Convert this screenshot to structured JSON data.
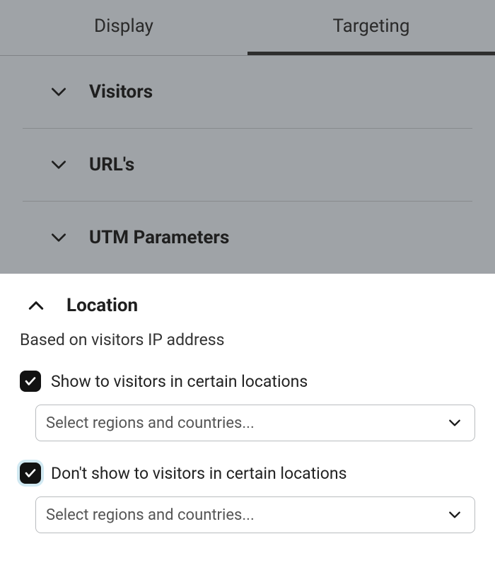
{
  "tabs": {
    "display": {
      "label": "Display",
      "active": false
    },
    "targeting": {
      "label": "Targeting",
      "active": true
    }
  },
  "accordion": {
    "visitors": {
      "label": "Visitors"
    },
    "urls": {
      "label": "URL's"
    },
    "utm": {
      "label": "UTM Parameters"
    },
    "location": {
      "label": "Location"
    }
  },
  "location_panel": {
    "subtitle": "Based on visitors IP address",
    "show_option": {
      "label": "Show to visitors in certain locations",
      "checked": true,
      "select_placeholder": "Select regions and countries..."
    },
    "hide_option": {
      "label": "Don't show to visitors in certain locations",
      "checked": true,
      "select_placeholder": "Select regions and countries..."
    }
  }
}
